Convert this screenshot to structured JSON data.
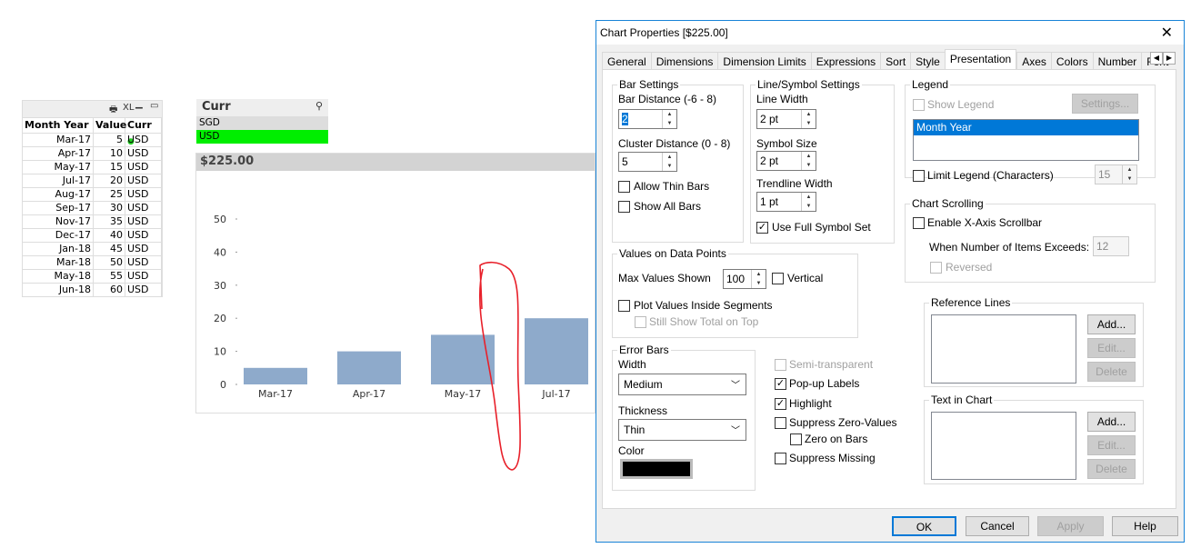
{
  "table": {
    "toolbar": [
      "print-icon",
      "XL",
      "minimize-icon",
      "maximize-icon"
    ],
    "xl_label": "XL",
    "headers": [
      "Month Year",
      "Value",
      "Curr"
    ],
    "rows": [
      [
        "Mar-17",
        "5",
        "USD"
      ],
      [
        "Apr-17",
        "10",
        "USD"
      ],
      [
        "May-17",
        "15",
        "USD"
      ],
      [
        "Jul-17",
        "20",
        "USD"
      ],
      [
        "Aug-17",
        "25",
        "USD"
      ],
      [
        "Sep-17",
        "30",
        "USD"
      ],
      [
        "Nov-17",
        "35",
        "USD"
      ],
      [
        "Dec-17",
        "40",
        "USD"
      ],
      [
        "Jan-18",
        "45",
        "USD"
      ],
      [
        "Mar-18",
        "50",
        "USD"
      ],
      [
        "May-18",
        "55",
        "USD"
      ],
      [
        "Jun-18",
        "60",
        "USD"
      ]
    ]
  },
  "listbox": {
    "title": "Curr",
    "items": [
      "SGD",
      "USD"
    ],
    "selected": "USD",
    "selected_color": "#00ee00"
  },
  "chart_data": {
    "type": "bar",
    "title": "$225.00",
    "categories": [
      "Mar-17",
      "Apr-17",
      "May-17",
      "Jul-17"
    ],
    "values": [
      5,
      10,
      15,
      20
    ],
    "yticks": [
      "0",
      "10",
      "20",
      "30",
      "40",
      "50"
    ],
    "ylim": [
      0,
      50
    ],
    "bar_color": "#8eaacb",
    "grid": false
  },
  "dialog": {
    "title": "Chart Properties [$225.00]",
    "tabs": [
      "General",
      "Dimensions",
      "Dimension Limits",
      "Expressions",
      "Sort",
      "Style",
      "Presentation",
      "Axes",
      "Colors",
      "Number",
      "Font"
    ],
    "active_tab": "Presentation",
    "bar": {
      "label": "Bar Settings",
      "bar_distance_label": "Bar Distance (-6 - 8)",
      "bar_distance": "2",
      "cluster_label": "Cluster Distance (0 - 8)",
      "cluster": "5",
      "allow_thin": "Allow Thin Bars",
      "show_all": "Show All Bars"
    },
    "line": {
      "label": "Line/Symbol Settings",
      "line_width_label": "Line Width",
      "line_width": "2 pt",
      "symbol_size_label": "Symbol Size",
      "symbol_size": "2 pt",
      "trend_label": "Trendline Width",
      "trend": "1 pt",
      "full_symbol": "Use Full Symbol Set"
    },
    "legend": {
      "label": "Legend",
      "show": "Show Legend",
      "settings": "Settings...",
      "item": "Month Year",
      "limit": "Limit Legend (Characters)",
      "limit_value": "15"
    },
    "scroll": {
      "label": "Chart Scrolling",
      "enable": "Enable X-Axis Scrollbar",
      "exceeds": "When Number of Items Exceeds:",
      "exceeds_value": "12",
      "reversed": "Reversed"
    },
    "values": {
      "label": "Values on Data Points",
      "max_label": "Max Values Shown",
      "max": "100",
      "vertical": "Vertical",
      "inside": "Plot Values Inside Segments",
      "total": "Still Show Total on Top"
    },
    "error": {
      "label": "Error Bars",
      "width_label": "Width",
      "width": "Medium",
      "thickness_label": "Thickness",
      "thickness": "Thin",
      "color_label": "Color",
      "color": "#000000"
    },
    "opts": {
      "semi": "Semi-transparent",
      "popup": "Pop-up Labels",
      "highlight": "Highlight",
      "suppress_zero": "Suppress Zero-Values",
      "zero_bars": "Zero on Bars",
      "suppress_missing": "Suppress Missing"
    },
    "ref": {
      "label": "Reference Lines",
      "add": "Add...",
      "edit": "Edit...",
      "delete": "Delete"
    },
    "text": {
      "label": "Text in Chart",
      "add": "Add...",
      "edit": "Edit...",
      "delete": "Delete"
    },
    "buttons": {
      "ok": "OK",
      "cancel": "Cancel",
      "apply": "Apply",
      "help": "Help"
    }
  },
  "annotation_color": "#e8202a"
}
